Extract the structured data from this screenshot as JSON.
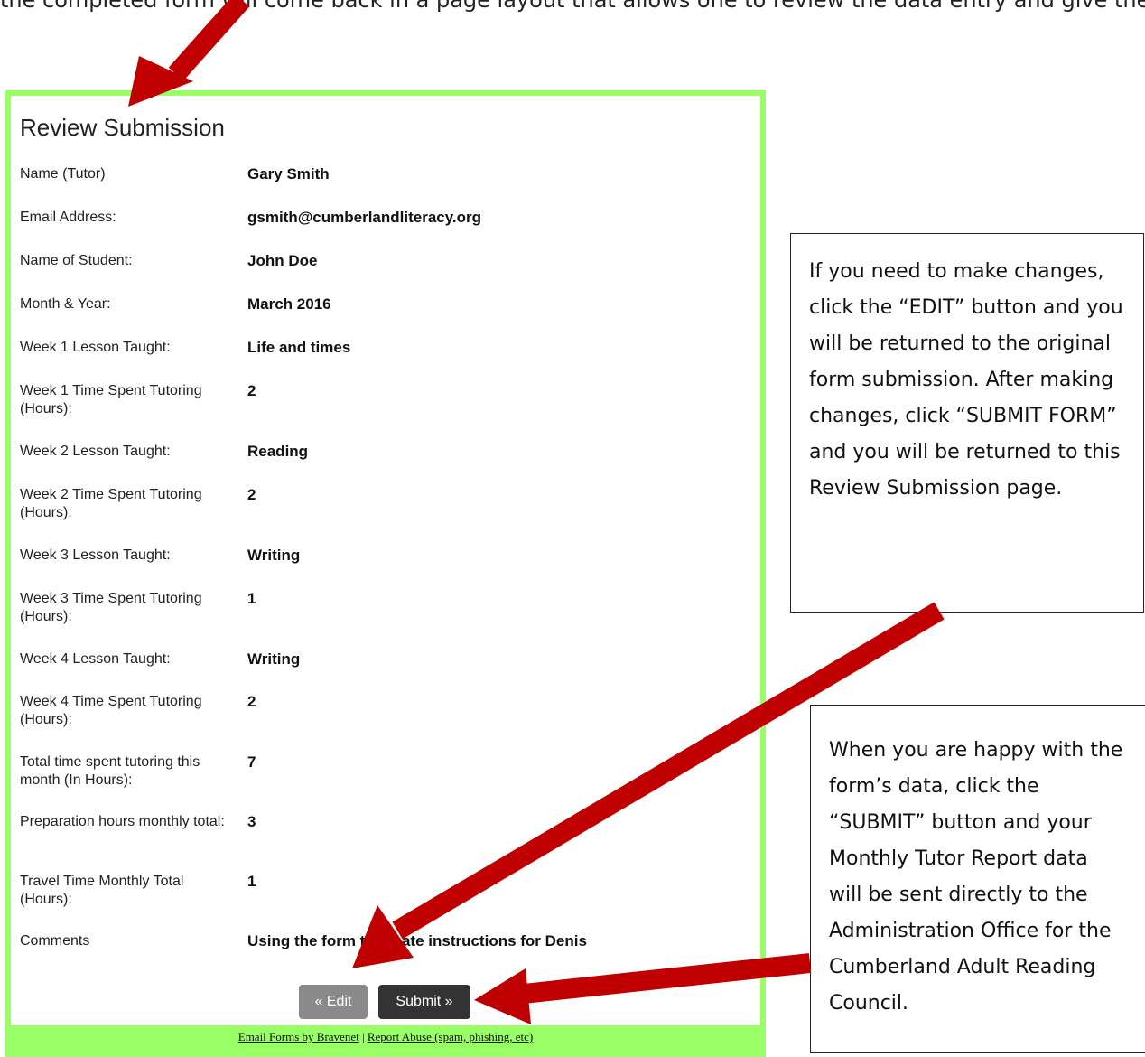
{
  "top_text": "the completed form will come back in a page layout that allows one to review the data entry and give the",
  "form": {
    "title": "Review Submission",
    "rows": [
      {
        "label": "Name (Tutor)",
        "value": "Gary Smith"
      },
      {
        "label": "Email Address:",
        "value": "gsmith@cumberlandliteracy.org"
      },
      {
        "label": "Name of Student:",
        "value": "John Doe"
      },
      {
        "label": "Month & Year:",
        "value": "March 2016"
      },
      {
        "label": "Week 1 Lesson Taught:",
        "value": "Life and times"
      },
      {
        "label": "Week 1 Time Spent Tutoring (Hours):",
        "value": "2"
      },
      {
        "label": "Week 2 Lesson Taught:",
        "value": "Reading"
      },
      {
        "label": "Week 2 Time Spent Tutoring (Hours):",
        "value": "2"
      },
      {
        "label": "Week 3 Lesson Taught:",
        "value": "Writing"
      },
      {
        "label": "Week 3 Time Spent Tutoring (Hours):",
        "value": "1"
      },
      {
        "label": "Week 4 Lesson Taught:",
        "value": "Writing"
      },
      {
        "label": "Week 4 Time Spent Tutoring (Hours):",
        "value": "2"
      },
      {
        "label": "Total time spent tutoring this month (In Hours):",
        "value": "7"
      },
      {
        "label": "Preparation hours monthly total:",
        "value": "3"
      },
      {
        "label": "Travel Time Monthly Total (Hours):",
        "value": "1"
      },
      {
        "label": "Comments",
        "value": "Using the form to create instructions for Denis"
      }
    ],
    "edit_button": "« Edit",
    "submit_button": "Submit »",
    "footer_link_1": "Email Forms by Bravenet",
    "footer_sep": "|",
    "footer_link_2": "Report Abuse (spam, phishing, etc)"
  },
  "notes": {
    "edit_note": "If you need to make changes, click the “EDIT” button and you will be returned to the original form submission. After making changes, click “SUBMIT FORM” and you will be returned to this Review Submission page.",
    "submit_note": "When you are happy with the form’s data, click the “SUBMIT” button and your Monthly Tutor Report data will be sent directly to the Administration Office for the Cumberland Adult Reading Council."
  },
  "colors": {
    "frame": "#99ff66",
    "arrow": "#c00000",
    "edit_button": "#8a8a8a",
    "submit_button": "#333333"
  }
}
